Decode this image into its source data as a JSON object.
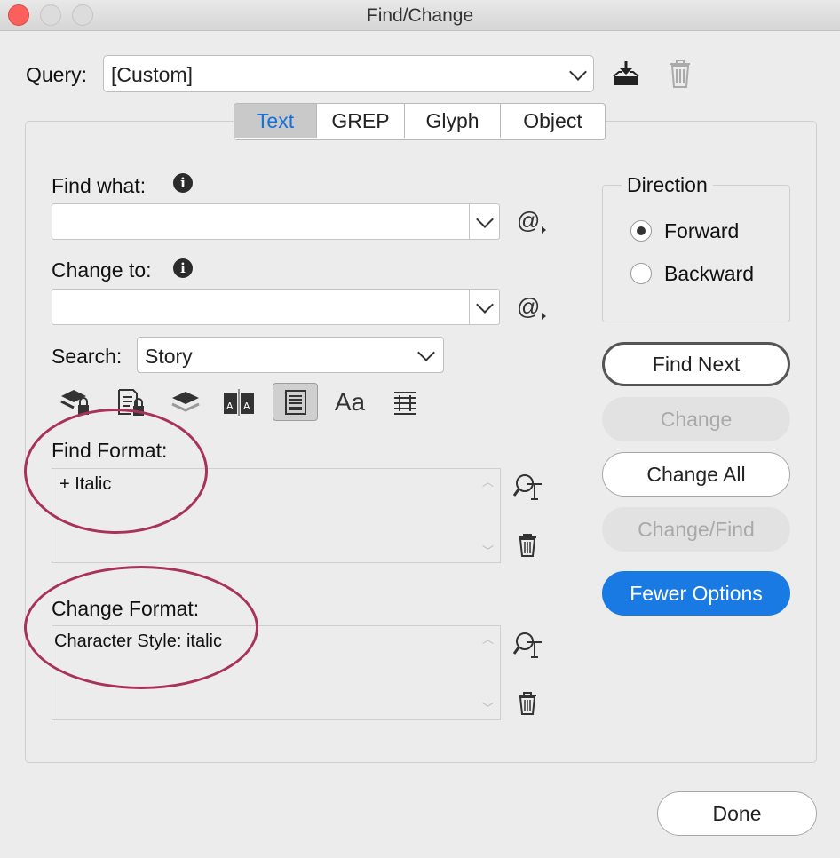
{
  "window": {
    "title": "Find/Change"
  },
  "query": {
    "label": "Query:",
    "value": "[Custom]"
  },
  "tabs": [
    {
      "label": "Text",
      "selected": true
    },
    {
      "label": "GREP",
      "selected": false
    },
    {
      "label": "Glyph",
      "selected": false
    },
    {
      "label": "Object",
      "selected": false
    }
  ],
  "find_what": {
    "label": "Find what:",
    "value": ""
  },
  "change_to": {
    "label": "Change to:",
    "value": ""
  },
  "search": {
    "label": "Search:",
    "value": "Story"
  },
  "find_format": {
    "label": "Find Format:",
    "value": "+ Italic"
  },
  "change_format": {
    "label": "Change Format:",
    "value": "Character Style: italic"
  },
  "direction": {
    "title": "Direction",
    "options": [
      {
        "label": "Forward",
        "selected": true
      },
      {
        "label": "Backward",
        "selected": false
      }
    ]
  },
  "buttons": {
    "find_next": "Find Next",
    "change": "Change",
    "change_all": "Change All",
    "change_find": "Change/Find",
    "fewer_options": "Fewer Options",
    "done": "Done"
  },
  "option_icons": [
    "include-locked-layers-icon",
    "include-locked-stories-icon",
    "include-hidden-layers-icon",
    "include-master-pages-icon",
    "include-footnotes-icon",
    "case-sensitive-icon",
    "whole-word-icon"
  ],
  "colors": {
    "accent": "#1a7ae3",
    "annotation": "#a8325c",
    "close": "#fc605c"
  }
}
